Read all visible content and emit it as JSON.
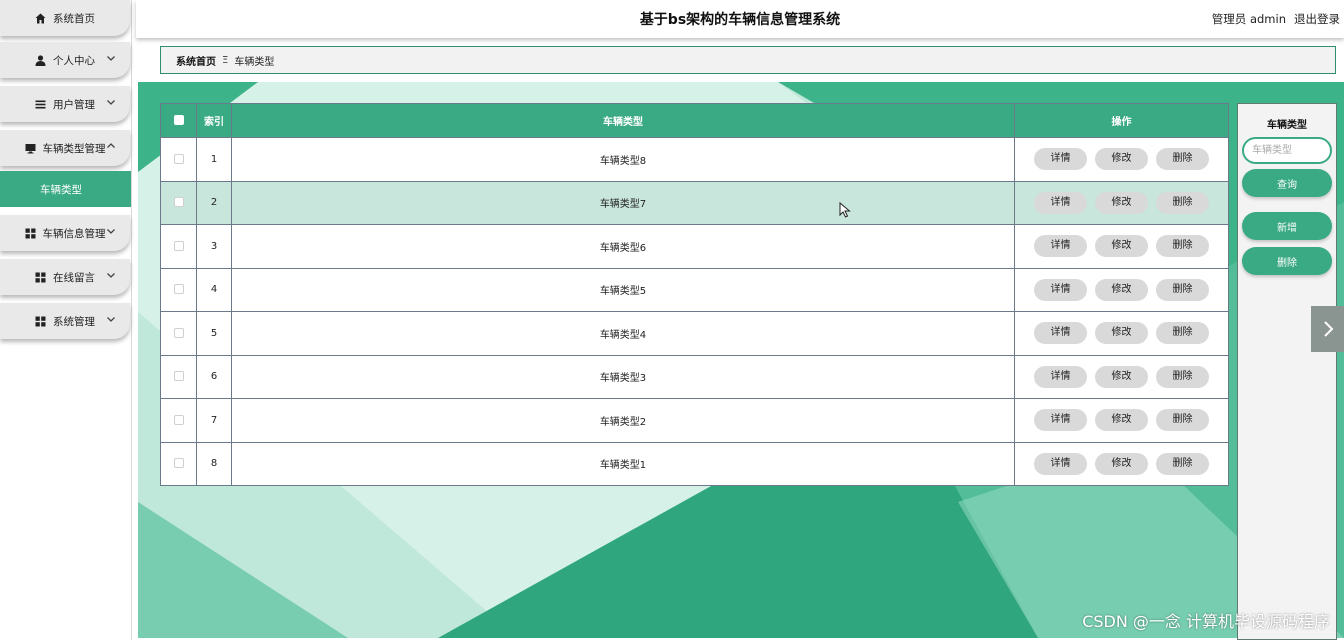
{
  "app": {
    "title": "基于bs架构的车辆信息管理系统"
  },
  "header": {
    "user": "管理员 admin",
    "logout": "退出登录"
  },
  "sidebar": {
    "items": [
      {
        "label": "系统首页",
        "icon": "home-icon"
      },
      {
        "label": "个人中心",
        "icon": "user-icon"
      },
      {
        "label": "用户管理",
        "icon": "list-icon"
      },
      {
        "label": "车辆类型管理",
        "icon": "monitor-icon"
      },
      {
        "label": "车辆信息管理",
        "icon": "grid-icon"
      },
      {
        "label": "在线留言",
        "icon": "grid-icon"
      },
      {
        "label": "系统管理",
        "icon": "grid-icon"
      }
    ],
    "active_sub": "车辆类型"
  },
  "breadcrumb": {
    "home": "系统首页",
    "separator": "Ξ",
    "current": "车辆类型"
  },
  "table": {
    "headers": {
      "index": "索引",
      "type": "车辆类型",
      "ops": "操作"
    },
    "rows": [
      {
        "index": "1",
        "type": "车辆类型8"
      },
      {
        "index": "2",
        "type": "车辆类型7"
      },
      {
        "index": "3",
        "type": "车辆类型6"
      },
      {
        "index": "4",
        "type": "车辆类型5"
      },
      {
        "index": "5",
        "type": "车辆类型4"
      },
      {
        "index": "6",
        "type": "车辆类型3"
      },
      {
        "index": "7",
        "type": "车辆类型2"
      },
      {
        "index": "8",
        "type": "车辆类型1"
      }
    ],
    "actions": {
      "detail": "详情",
      "edit": "修改",
      "delete": "删除"
    }
  },
  "panel": {
    "title": "车辆类型",
    "search_placeholder": "车辆类型",
    "query": "查询",
    "add": "新增",
    "delete": "删除"
  },
  "watermark": "CSDN @一念 计算机毕设源码程序",
  "colors": {
    "accent": "#3aaa84",
    "highlight_row": "#c8e6dc"
  }
}
